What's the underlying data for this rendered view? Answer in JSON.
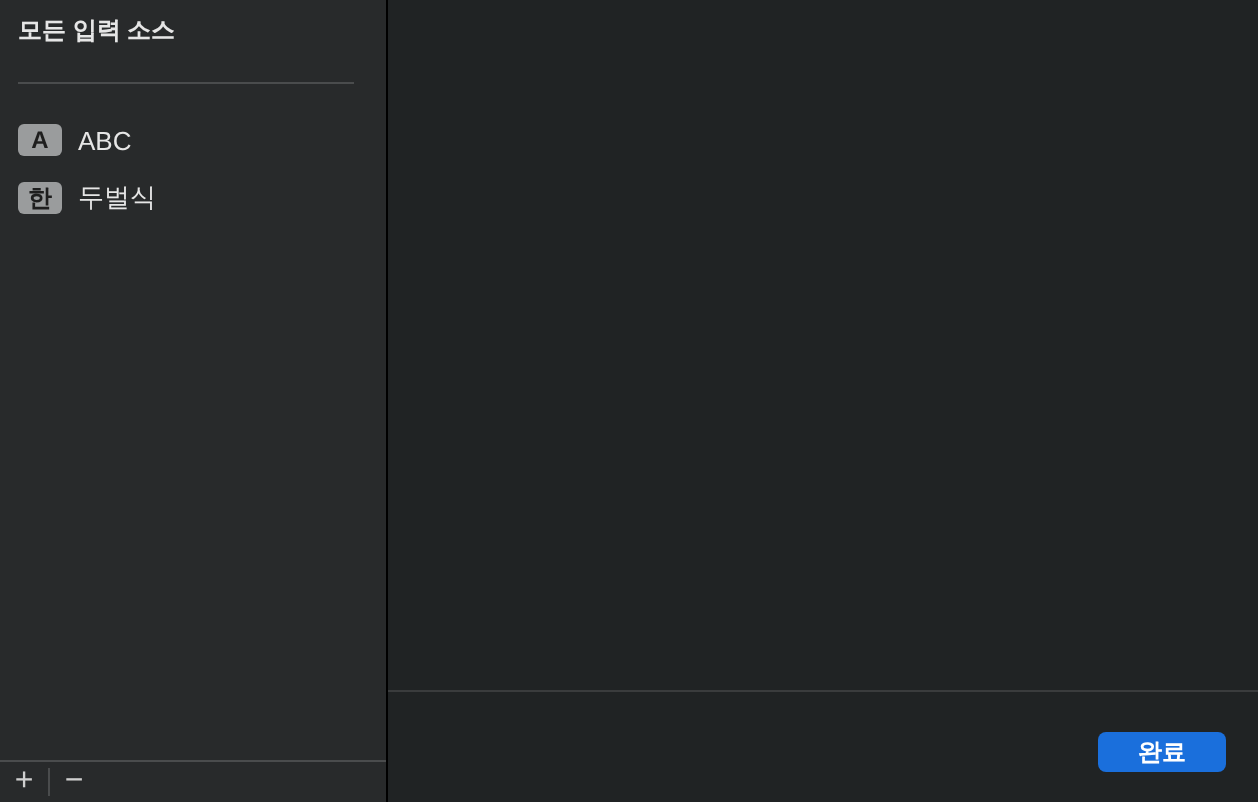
{
  "sidebar": {
    "title": "모든 입력 소스",
    "items": [
      {
        "badge": "A",
        "label": "ABC"
      },
      {
        "badge": "한",
        "label": "두벌식"
      }
    ],
    "buttons": [
      "+",
      "−"
    ]
  },
  "footer": {
    "buttons": [
      "완료"
    ]
  }
}
